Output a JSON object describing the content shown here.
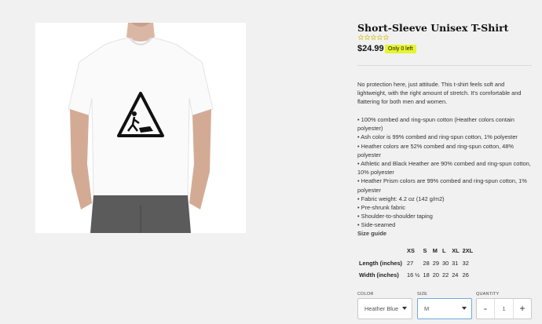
{
  "product": {
    "title": "Short-Sleeve Unisex T-Shirt",
    "rating_stars": 5,
    "rating_filled": 0,
    "price": "$24.99",
    "stock_badge": "Only 0 left",
    "description": "No protection here, just attitude. This t-shirt feels soft and lightweight, with the right amount of stretch. It's comfortable and flattering for both men and women.",
    "features": [
      "100% combed and ring-spun cotton (Heather colors contain polyester)",
      "Ash color is 99% combed and ring-spun cotton, 1% polyester",
      "Heather colors are 52% combed and ring-spun cotton, 48% polyester",
      "Athletic and Black Heather are 90% combed and ring-spun cotton, 10% polyester",
      "Heather Prism colors are 99% combed and ring-spun cotton, 1% polyester",
      "Fabric weight: 4.2 oz (142 g/m2)",
      "Pre-shrunk fabric",
      "Shoulder-to-shoulder taping",
      "Side-seamed"
    ],
    "size_guide_label": "Size guide"
  },
  "size_table": {
    "headers": [
      "",
      "XS",
      "S",
      "M",
      "L",
      "XL",
      "2XL"
    ],
    "rows": [
      {
        "label": "Length (inches)",
        "values": [
          "27",
          "28",
          "29",
          "30",
          "31",
          "32"
        ]
      },
      {
        "label": "Width (inches)",
        "values": [
          "16 ½",
          "18",
          "20",
          "22",
          "24",
          "26"
        ]
      }
    ]
  },
  "options": {
    "color_label": "COLOR",
    "color_value": "Heather Blue",
    "size_label": "SIZE",
    "size_value": "M",
    "quantity_label": "QUANTITY",
    "quantity_value": "1",
    "minus": "-",
    "plus": "+"
  },
  "colors": {
    "badge": "#e6f52e",
    "star": "#d6c21a",
    "active_border": "#6fa8dc"
  },
  "icons": {
    "star": "star-outline-icon",
    "caret": "chevron-down-icon"
  }
}
